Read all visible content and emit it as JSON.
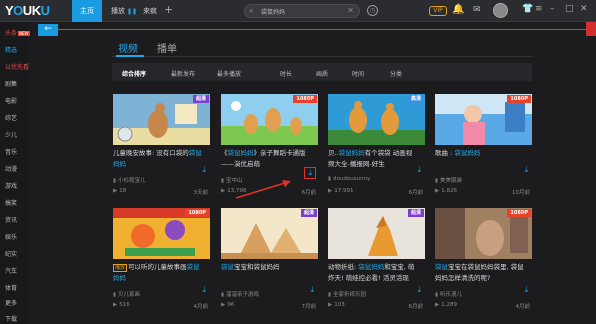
{
  "app": {
    "logo": "YOUKU",
    "top_tabs": [
      "主页",
      "播放",
      "来疯"
    ],
    "search": {
      "value": "袋鼠妈妈",
      "placeholder": ""
    },
    "vip_label": "VIP",
    "accent_color": "#1a9be0"
  },
  "sidebar": {
    "items": [
      {
        "label": "头条",
        "badge": "NEW"
      },
      {
        "label": "精选"
      },
      {
        "label": "以优先看"
      },
      {
        "label": "剧集"
      },
      {
        "label": "电影"
      },
      {
        "label": "综艺"
      },
      {
        "label": "少儿"
      },
      {
        "label": "音乐"
      },
      {
        "label": "动漫"
      },
      {
        "label": "游戏"
      },
      {
        "label": "搞笑"
      },
      {
        "label": "资讯"
      },
      {
        "label": "娱乐"
      },
      {
        "label": "纪实"
      },
      {
        "label": "汽车"
      },
      {
        "label": "体育"
      },
      {
        "label": "更多"
      }
    ],
    "bottom": "下载"
  },
  "content_tabs": [
    "视频",
    "播单"
  ],
  "filters": [
    "综合排序",
    "最新发布",
    "最多播放",
    "时长",
    "画质",
    "时间",
    "分类"
  ],
  "cards": [
    {
      "badge": "超清",
      "badge_type": "bsuper",
      "title_pre": "儿童晚安故事: 没有口袋的",
      "title_hl": "袋鼠妈妈",
      "title_post": "",
      "author": "小杉瓶宝儿",
      "views": "18",
      "time": "3天前",
      "tag": ""
    },
    {
      "badge": "1080P",
      "badge_type": "b1080",
      "title_pre": "《",
      "title_hl": "袋鼠妈妈",
      "title_post": "》亲子舞蹈卡通版——演优启萌",
      "author": "宝中山",
      "views": "13,798",
      "time": "6月前",
      "tag": ""
    },
    {
      "badge": "高清",
      "badge_type": "bsd",
      "title_pre": "贝..",
      "title_hl": "袋鼠妈妈",
      "title_post": "有个袋袋 动画视频大全-播报网-好生",
      "author": "doudousunny",
      "views": "17,991",
      "time": "6月前",
      "tag": ""
    },
    {
      "badge": "1080P",
      "badge_type": "b1080",
      "title_pre": "歌曲 : ",
      "title_hl": "袋鼠妈妈",
      "title_post": "",
      "author": "美美服装",
      "views": "1,826",
      "time": "10月前",
      "tag": ""
    },
    {
      "badge": "1080P",
      "badge_type": "b1080",
      "title_pre": "可以听的儿童故事画",
      "title_hl": "袋鼠妈妈",
      "title_post": "",
      "author": "贝儿家画",
      "views": "516",
      "time": "4月前",
      "tag": "播放"
    },
    {
      "badge": "超清",
      "badge_type": "bsuper",
      "title_pre": "",
      "title_hl": "袋鼠",
      "title_post": "宝宝和袋鼠妈妈",
      "author": "溜溜亲子游戏",
      "views": "96",
      "time": "7月前",
      "tag": ""
    },
    {
      "badge": "超清",
      "badge_type": "bsuper",
      "title_pre": "动物折纸: ",
      "title_hl": "袋鼠妈妈",
      "title_post": "和宝宝, 萌炸天! 萌娃控必看! 活灵活现",
      "author": "全家折纸乐园",
      "views": "103",
      "time": "6月前",
      "tag": ""
    },
    {
      "badge": "1080P",
      "badge_type": "b1080",
      "title_pre": "",
      "title_hl": "袋鼠",
      "title_post": "宝宝在袋鼠妈妈袋里, 袋鼠妈妈怎样清洗的呢?",
      "author": "听乐漫儿",
      "views": "1,289",
      "time": "4月前",
      "tag": ""
    }
  ]
}
